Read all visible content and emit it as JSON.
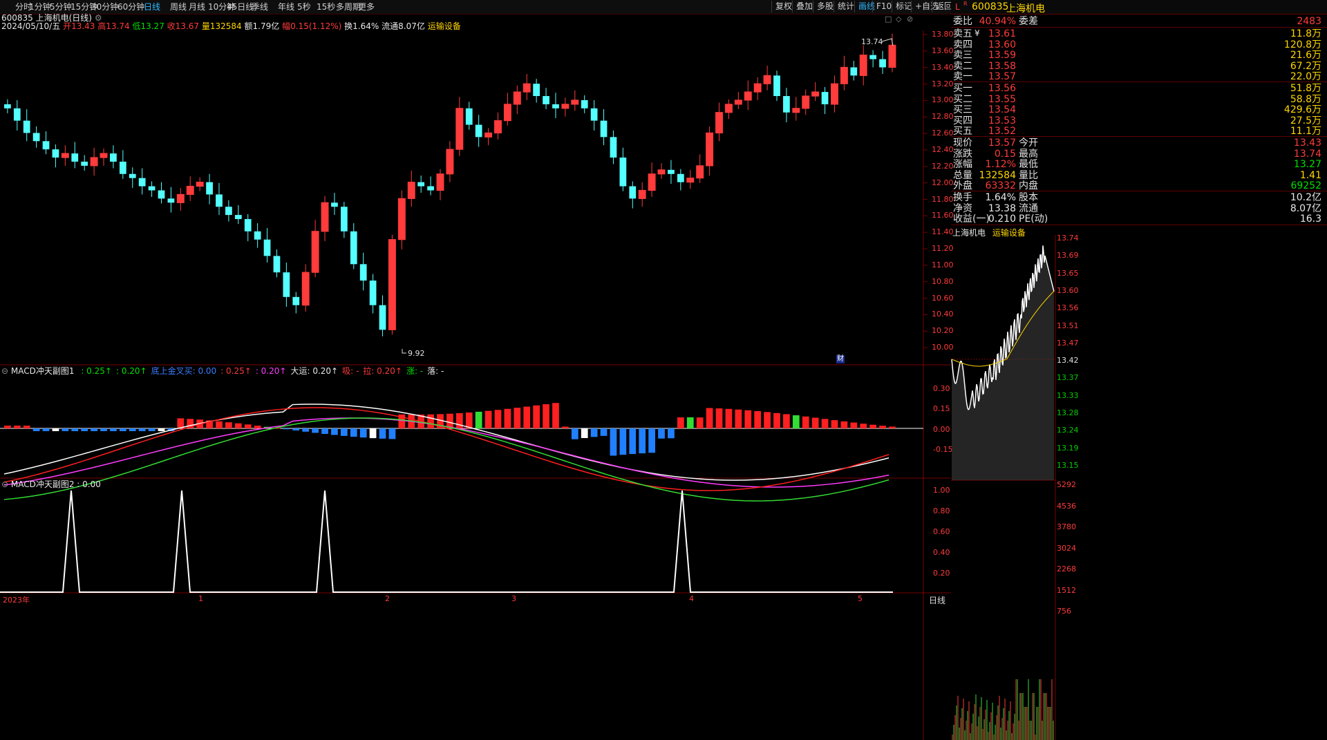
{
  "toolbar": {
    "periods": [
      "分时",
      "1分钟",
      "5分钟",
      "15分钟",
      "30分钟",
      "60分钟",
      "日线",
      "周线",
      "月线",
      "10分钟",
      "45日线",
      "季线",
      "年线",
      "5秒",
      "15秒",
      "多周期",
      "更多"
    ],
    "active_period": "日线",
    "right_buttons": [
      "复权",
      "叠加",
      "多股",
      "统计",
      "画线",
      "F10",
      "标记",
      "+自选",
      "返回"
    ],
    "active_right": "画线",
    "window_controls": [
      "□",
      "◇",
      "⊘"
    ]
  },
  "chart_header": {
    "title": "600835 上海机电(日线)",
    "date": "2024/05/10/五",
    "open_label": "开",
    "open": "13.43",
    "high_label": "高",
    "high": "13.74",
    "low_label": "低",
    "low": "13.27",
    "close_label": "收",
    "close": "13.67",
    "vol_label": "量",
    "vol": "132584",
    "amount_label": "额",
    "amount": "1.79亿",
    "change_label": "幅",
    "change": "0.15(1.12%)",
    "turnover_label": "换",
    "turnover": "1.64%",
    "float_label": "流通",
    "float": "8.07亿",
    "sector": "运输设备"
  },
  "price_axis": [
    "13.80",
    "13.60",
    "13.40",
    "13.20",
    "13.00",
    "12.80",
    "12.60",
    "12.40",
    "12.20",
    "12.00",
    "11.80",
    "11.60",
    "11.40",
    "11.20",
    "11.00",
    "10.80",
    "10.60",
    "10.40",
    "10.20",
    "10.00"
  ],
  "annotations": {
    "high_mark": "13.74",
    "low_mark": "9.92",
    "finance_badge": "财"
  },
  "macd1": {
    "title": "MACD冲天副图1",
    "values": [
      {
        "t": ": 0.25↑",
        "c": "green"
      },
      {
        "t": ": 0.20↑",
        "c": "green"
      },
      {
        "t": "底上金叉买: 0.00",
        "c": "blue"
      },
      {
        "t": ": 0.25↑",
        "c": "red"
      },
      {
        "t": ": 0.20↑",
        "c": "magenta"
      },
      {
        "t": "大运: 0.20↑",
        "c": "white"
      },
      {
        "t": "吸: -",
        "c": "red"
      },
      {
        "t": "拉: 0.20↑",
        "c": "red"
      },
      {
        "t": "涨: -",
        "c": "green"
      },
      {
        "t": "落: -",
        "c": "white"
      }
    ],
    "axis": [
      "0.30",
      "0.15",
      "0.00",
      "-0.15"
    ]
  },
  "macd2": {
    "title": "MACD冲天副图2 : 0.00",
    "axis": [
      "1.00",
      "0.80",
      "0.60",
      "0.40",
      "0.20"
    ]
  },
  "date_axis": [
    "2023年",
    "1",
    "2",
    "3",
    "4",
    "5"
  ],
  "bottom_period": "日线",
  "side": {
    "code": "600835",
    "name": "上海机电",
    "badge_l": "L",
    "badge_r": "R",
    "weibi_label": "委比",
    "weibi": "40.94%",
    "weicha_label": "委差",
    "weicha": "2483",
    "asks": [
      {
        "label": "卖五",
        "price": "13.61",
        "vol": "11.8万"
      },
      {
        "label": "卖四",
        "price": "13.60",
        "vol": "120.8万"
      },
      {
        "label": "卖三",
        "price": "13.59",
        "vol": "21.6万"
      },
      {
        "label": "卖二",
        "price": "13.58",
        "vol": "67.2万"
      },
      {
        "label": "卖一",
        "price": "13.57",
        "vol": "22.0万"
      }
    ],
    "ask_marker": "¥",
    "bids": [
      {
        "label": "买一",
        "price": "13.56",
        "vol": "51.8万"
      },
      {
        "label": "买二",
        "price": "13.55",
        "vol": "58.8万"
      },
      {
        "label": "买三",
        "price": "13.54",
        "vol": "429.6万"
      },
      {
        "label": "买四",
        "price": "13.53",
        "vol": "27.5万"
      },
      {
        "label": "买五",
        "price": "13.52",
        "vol": "11.1万"
      }
    ],
    "stats": [
      {
        "k1": "现价",
        "v1": "13.57",
        "k2": "今开",
        "v2": "13.43",
        "c1": "red",
        "c2": "red"
      },
      {
        "k1": "涨跌",
        "v1": "0.15",
        "k2": "最高",
        "v2": "13.74",
        "c1": "red",
        "c2": "red"
      },
      {
        "k1": "涨幅",
        "v1": "1.12%",
        "k2": "最低",
        "v2": "13.27",
        "c1": "red",
        "c2": "green"
      },
      {
        "k1": "总量",
        "v1": "132584",
        "k2": "量比",
        "v2": "1.41",
        "c1": "yellow",
        "c2": "yellow"
      },
      {
        "k1": "外盘",
        "v1": "63332",
        "k2": "内盘",
        "v2": "69252",
        "c1": "red",
        "c2": "green"
      }
    ],
    "stats2": [
      {
        "k1": "换手",
        "v1": "1.64%",
        "k2": "股本",
        "v2": "10.2亿"
      },
      {
        "k1": "净资",
        "v1": "13.38",
        "k2": "流通",
        "v2": "8.07亿"
      },
      {
        "k1": "收益(一)",
        "v1": "0.210",
        "k2": "PE(动)",
        "v2": "16.3"
      }
    ],
    "mini_title": "上海机电",
    "mini_sector": "运输设备",
    "mini_axis": [
      "13.74",
      "13.69",
      "13.65",
      "13.60",
      "13.56",
      "13.51",
      "13.47",
      "13.42",
      "13.37",
      "13.33",
      "13.28",
      "13.24",
      "13.19",
      "13.15"
    ],
    "vol_axis": [
      "5292",
      "4536",
      "3780",
      "3024",
      "2268",
      "1512",
      "756"
    ]
  }
}
